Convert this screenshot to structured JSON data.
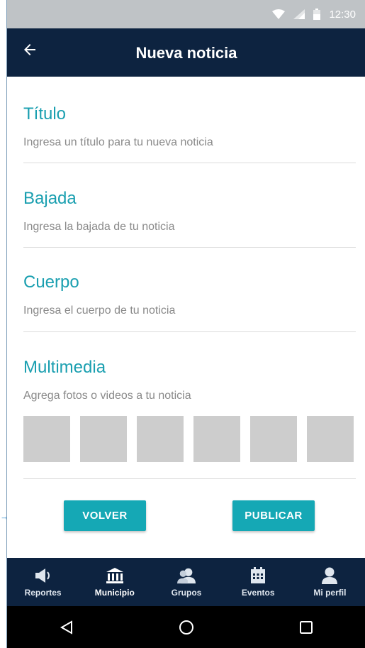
{
  "status_bar": {
    "time": "12:30"
  },
  "app_bar": {
    "title": "Nueva noticia",
    "back_icon": "arrow-left-icon"
  },
  "sections": [
    {
      "title": "Título",
      "hint": "Ingresa un título para tu nueva noticia"
    },
    {
      "title": "Bajada",
      "hint": "Ingresa la bajada de tu noticia"
    },
    {
      "title": "Cuerpo",
      "hint": "Ingresa el cuerpo de tu noticia"
    },
    {
      "title": "Multimedia",
      "hint": "Agrega fotos o videos a tu noticia"
    }
  ],
  "actions": {
    "back_label": "VOLVER",
    "publish_label": "PUBLICAR"
  },
  "bottom_nav": [
    {
      "label": "Reportes",
      "icon": "megaphone-icon"
    },
    {
      "label": "Municipio",
      "icon": "municipality-icon",
      "active": true
    },
    {
      "label": "Grupos",
      "icon": "group-icon"
    },
    {
      "label": "Eventos",
      "icon": "calendar-icon"
    },
    {
      "label": "Mi perfil",
      "icon": "profile-icon"
    }
  ],
  "colors": {
    "app_bar": "#0d2340",
    "accent": "#1a9fb0",
    "button": "#15a8b5",
    "placeholder_thumb": "#cdcdcd"
  }
}
